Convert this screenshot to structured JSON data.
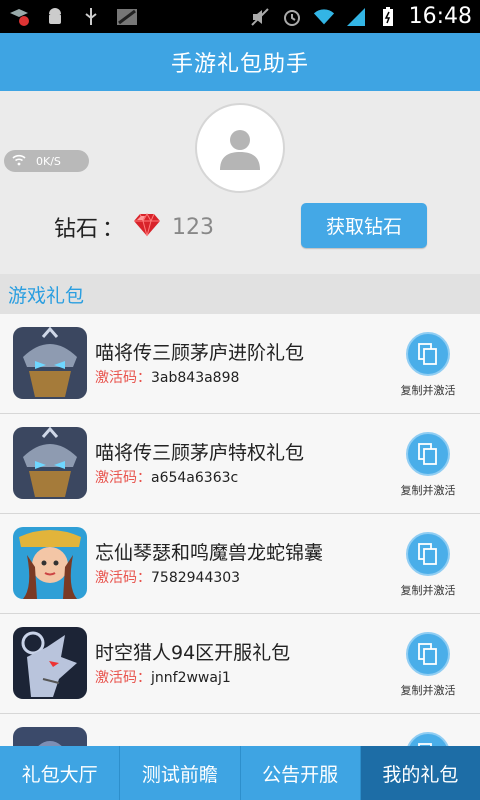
{
  "status_bar": {
    "time": "16:48"
  },
  "header": {
    "title": "手游礼包助手"
  },
  "profile": {
    "speed": "0K/S",
    "diamond_label": "钻石",
    "diamond_sep": "：",
    "diamond_count": "123",
    "get_button": "获取钻石"
  },
  "section": {
    "title": "游戏礼包"
  },
  "gifts": [
    {
      "name": "喵将传三顾茅庐进阶礼包",
      "code_label": "激活码：",
      "code": "3ab843a898",
      "copy_label": "复制并激活",
      "icon": "warrior-helmet"
    },
    {
      "name": "喵将传三顾茅庐特权礼包",
      "code_label": "激活码：",
      "code": "a654a6363c",
      "copy_label": "复制并激活",
      "icon": "warrior-helmet"
    },
    {
      "name": "忘仙琴瑟和鸣魔兽龙蛇锦囊",
      "code_label": "激活码：",
      "code": "7582944303",
      "copy_label": "复制并激活",
      "icon": "heroine-portrait"
    },
    {
      "name": "时空猎人94区开服礼包",
      "code_label": "激活码：",
      "code": "jnnf2wwaj1",
      "copy_label": "复制并激活",
      "icon": "wolf-warrior"
    },
    {
      "name": "",
      "code_label": "",
      "code": "",
      "copy_label": "",
      "icon": "partial"
    }
  ],
  "tabs": [
    {
      "label": "礼包大厅",
      "active": false
    },
    {
      "label": "测试前瞻",
      "active": false
    },
    {
      "label": "公告开服",
      "active": false
    },
    {
      "label": "我的礼包",
      "active": true
    }
  ],
  "colors": {
    "primary": "#3ea4e3",
    "active_tab": "#1d6da6",
    "code_label": "#e8544e",
    "section_text": "#2a9ee0"
  }
}
